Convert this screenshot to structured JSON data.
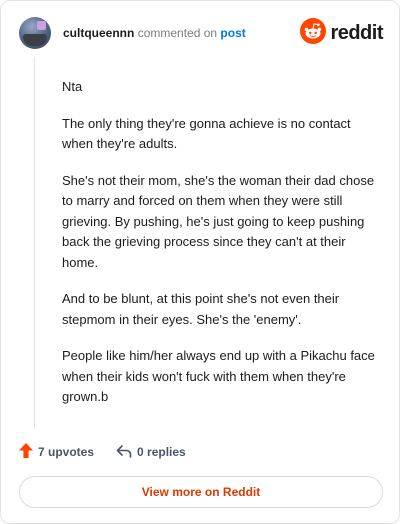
{
  "comment": {
    "username": "cultqueennn",
    "action": "commented on",
    "target": "post",
    "paragraphs": [
      "Nta",
      "The only thing they're gonna achieve is no contact when they're adults.",
      "She's not their mom, she's the woman their dad chose to marry and forced on them when they were still grieving. By pushing, he's just going to keep pushing back the grieving process since they can't at their home.",
      "And to be blunt, at this point she's not even their stepmom in their eyes. She's the 'enemy'.",
      "People like him/her always end up with a Pikachu face when their kids won't fuck with them when they're grown.b"
    ]
  },
  "brand": {
    "name": "reddit",
    "icon": "reddit-logo-icon",
    "color": "#ff4500"
  },
  "footer": {
    "upvotes": "7 upvotes",
    "replies": "0 replies",
    "upvote_icon": "upvote-arrow-icon",
    "reply_icon": "reply-arrow-icon",
    "upvote_color": "#ff4500"
  },
  "view_more": {
    "label": "View more on Reddit",
    "color": "#d93a00"
  }
}
